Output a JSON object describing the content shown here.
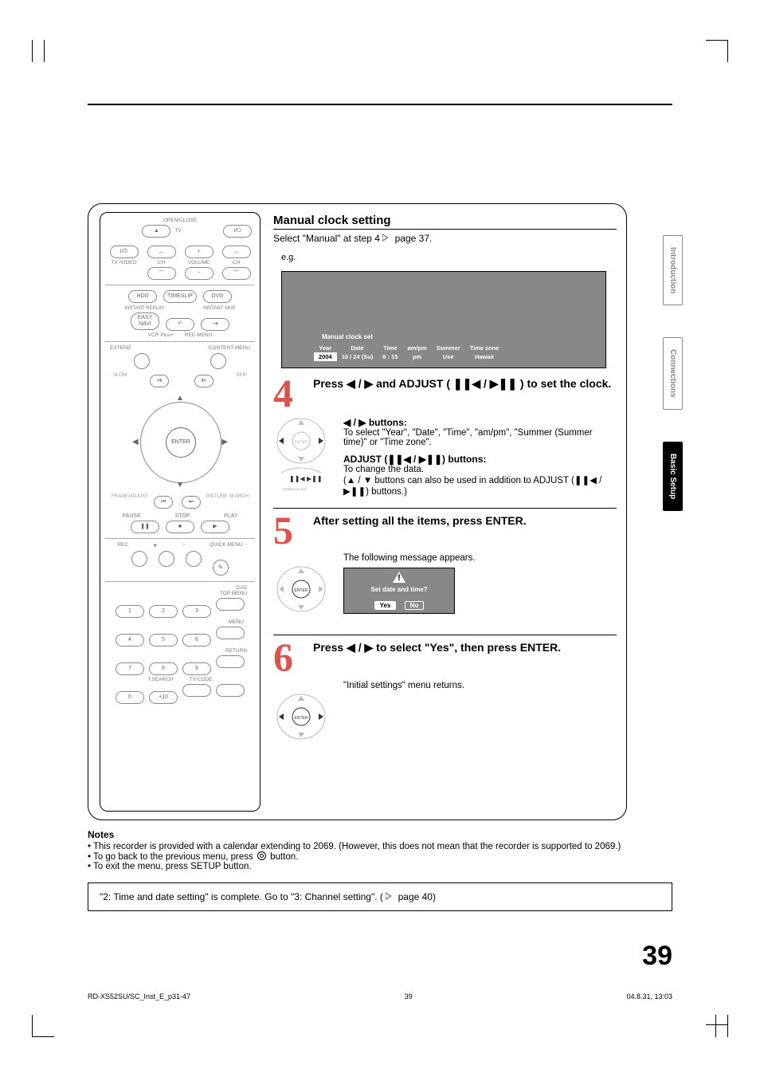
{
  "page_number": "39",
  "top_section": {
    "title": "Manual clock setting",
    "select_text_pre": "Select \"Manual\" at step 4 ",
    "select_text_post": " page 37.",
    "eg": "e.g."
  },
  "osd1": {
    "title": "Manual clock set",
    "headers": [
      "Year",
      "Date",
      "Time",
      "am/pm",
      "Summer",
      "Time zone"
    ],
    "values": [
      "2004",
      "10 / 24 (Su)",
      "6 : 15",
      "pm",
      "Use",
      "Hawaii"
    ]
  },
  "step4": {
    "num": "4",
    "head_pre": "Press ",
    "head_mid": " and ADJUST (",
    "head_post": ") to set the clock.",
    "lr_title": " buttons:",
    "lr_body": "To select \"Year\", \"Date\", \"Time\", \"am/pm\", \"Summer (Summer time)\" or \"Time zone\".",
    "adj_title_pre": "ADJUST (",
    "adj_title_post": ") buttons:",
    "adj_body": "To change the data.",
    "adj_note_pre": "(",
    "adj_note_mid": " buttons can also be used in addition to ADJUST (",
    "adj_note_post": ") buttons.)"
  },
  "step5": {
    "num": "5",
    "head": "After setting all the items, press ENTER.",
    "msg": "The following message appears.",
    "dialog_q": "Set date and time?",
    "dialog_yes": "Yes",
    "dialog_no": "No"
  },
  "step6": {
    "num": "6",
    "head_pre": "Press ",
    "head_post": " to select \"Yes\", then press ENTER.",
    "msg": "\"Initial settings\" menu returns."
  },
  "tabs": {
    "t1": "Introduction",
    "t2": "Connections",
    "t3": "Basic Setup"
  },
  "notes": {
    "title": "Notes",
    "n1": "This recorder is provided with a calendar extending to 2069. (However, this does not mean that the recorder is supported to 2069.)",
    "n2_pre": "To go back to the previous menu, press ",
    "n2_post": " button.",
    "n3": "To exit the menu, press SETUP button."
  },
  "complete": {
    "text_pre": "\"2: Time and date setting\" is complete. Go to \"3: Channel setting\". (",
    "text_post": " page 40)"
  },
  "footer": {
    "left": "RD-XS52SU/SC_Inst_E_p31-47",
    "mid": "39",
    "right": "04.8.31, 13:03"
  },
  "remote": {
    "openclose": "OPEN/CLOSE",
    "tv": "TV",
    "tv_video": "TV /VIDEO",
    "ch": "CH",
    "volume": "VOLUME",
    "hdd": "HDD",
    "timeslip": "TIMESLIP",
    "dvd": "DVD",
    "instant_replay": "INSTANT REPLAY",
    "instant_skip": "INSTANT SKIP",
    "easynavi": "EASY\nNAVI",
    "vcrplus": "VCR Plus+",
    "recmenu": "REC MENU",
    "extend": "EXTEND",
    "contentmenu": "CONTENT MENU",
    "slow": "SLOW",
    "skip": "SKIP",
    "enter": "ENTER",
    "frame_adjust": "FRAME/ADJUST",
    "picture_search": "PICTURE SEARCH",
    "pause": "PAUSE",
    "stop": "STOP",
    "play": "PLAY",
    "rec": "REC",
    "quickmenu": "QUICK MENU",
    "dvd2": "DVD",
    "topmenu": "TOP MENU",
    "menu": "MENU",
    "return": "RETURN",
    "tsearch": "T.SEARCH",
    "tvcode": "TV CODE",
    "n1": "1",
    "n2": "2",
    "n3": "3",
    "n4": "4",
    "n5": "5",
    "n6": "6",
    "n7": "7",
    "n8": "8",
    "n9": "9",
    "n0": "0",
    "n10": "+10",
    "power": "I/⏻"
  }
}
